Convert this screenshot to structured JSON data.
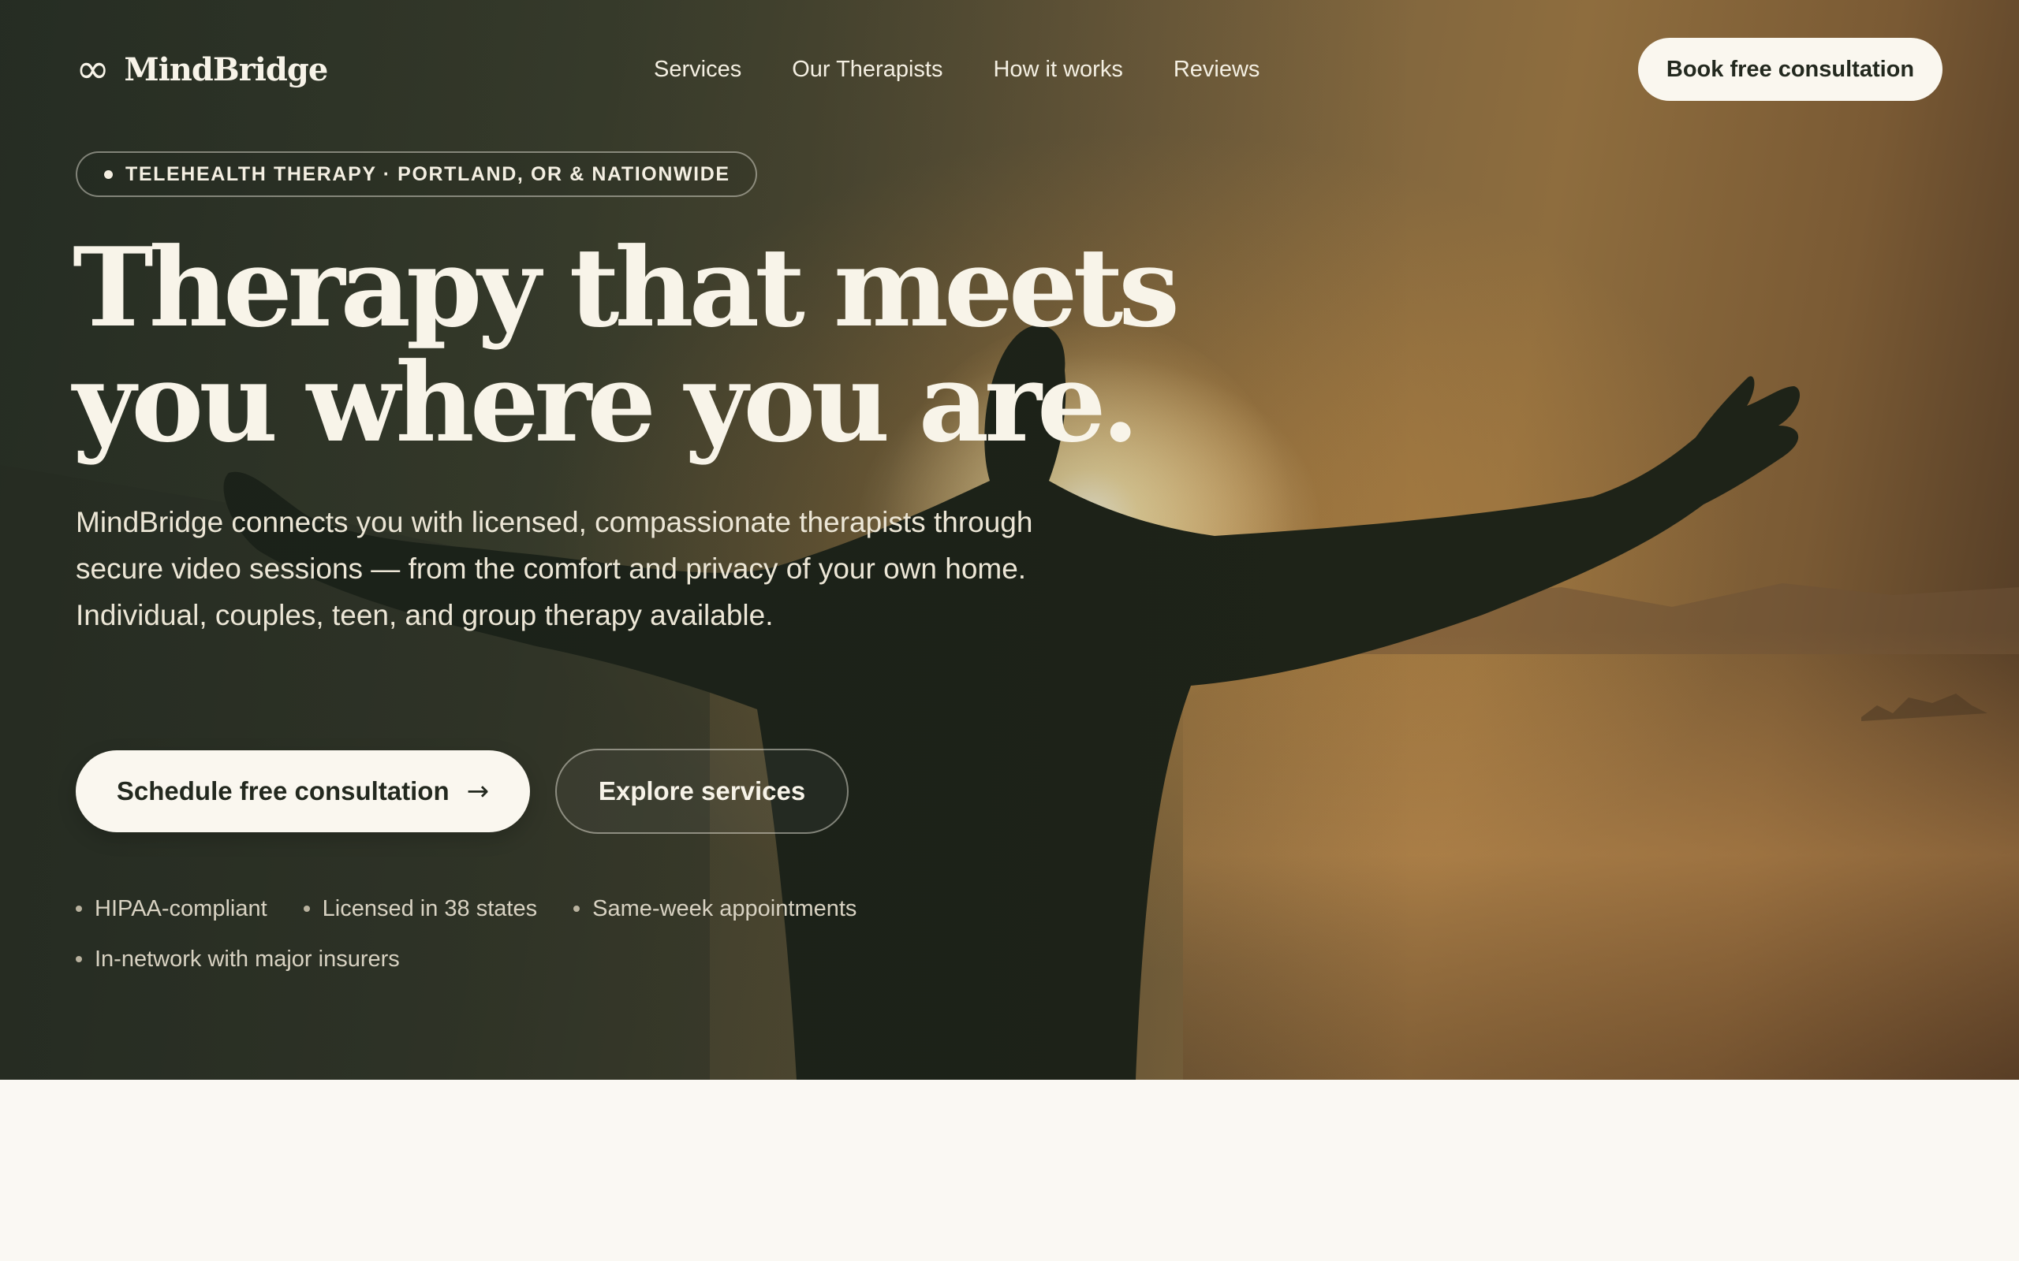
{
  "brand": {
    "name": "MindBridge",
    "icon": "infinity-icon",
    "icon_glyph": "∞"
  },
  "nav": {
    "links": [
      "Services",
      "Our Therapists",
      "How it works",
      "Reviews"
    ],
    "cta": "Book free consultation"
  },
  "hero": {
    "badge": "TELEHEALTH THERAPY · PORTLAND, OR & NATIONWIDE",
    "headline_line1": "Therapy that meets",
    "headline_line2": "you where you are.",
    "lede": "MindBridge connects you with licensed, compassionate therapists through secure video sessions — from the comfort and privacy of your own home. Individual, couples, teen, and group therapy available.",
    "primary_cta": "Schedule free consultation",
    "primary_cta_icon": "arrow-right-icon",
    "primary_cta_glyph": "→",
    "secondary_cta": "Explore services",
    "trust": [
      "HIPAA-compliant",
      "Licensed in 38 states",
      "Same-week appointments",
      "In-network with major insurers"
    ]
  },
  "colors": {
    "cream": "#faf7ef",
    "ink": "#23291f",
    "page_background": "#faf8f3"
  }
}
